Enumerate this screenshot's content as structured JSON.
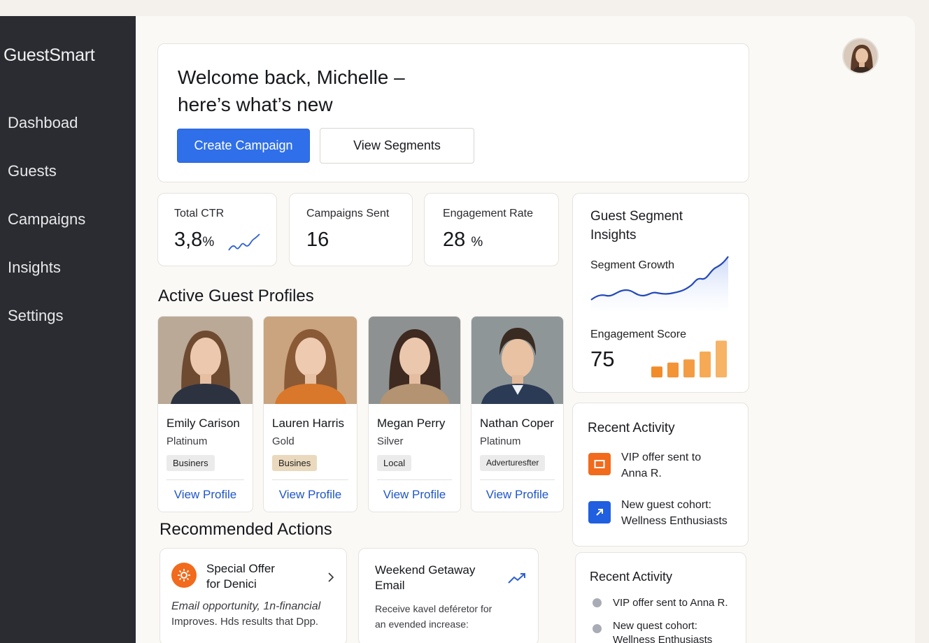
{
  "app": {
    "name": "GuestSmart"
  },
  "sidebar": {
    "items": [
      {
        "label": "Dashboad"
      },
      {
        "label": "Guests"
      },
      {
        "label": "Campaigns"
      },
      {
        "label": "Insights"
      },
      {
        "label": "Settings"
      }
    ]
  },
  "welcome": {
    "line1": "Welcome back, Michelle –",
    "line2": "here’s what’s new",
    "primary_label": "Create Campaign",
    "secondary_label": "View Segments"
  },
  "stats": [
    {
      "label": "Total CTR",
      "value": "3,8",
      "unit": "%"
    },
    {
      "label": "Campaigns Sent",
      "value": "16",
      "unit": ""
    },
    {
      "label": "Engagement Rate",
      "value": "28",
      "unit": "%"
    }
  ],
  "profiles_section": {
    "title": "Active Guest Profiles"
  },
  "profiles": [
    {
      "name": "Emily Carison",
      "tier": "Platinum",
      "tag": "Businers",
      "link": "View Profile",
      "tag_color": "#ebebec",
      "photo_bg": "#b9a996"
    },
    {
      "name": "Lauren Harris",
      "tier": "Gold",
      "tag": "Busines",
      "link": "View Profile",
      "tag_color": "#ead9bd",
      "photo_bg": "#c9a47e"
    },
    {
      "name": "Megan Perry",
      "tier": "Silver",
      "tag": "Local",
      "link": "View Profile",
      "tag_color": "#ebebec",
      "photo_bg": "#8d9191"
    },
    {
      "name": "Nathan Coper",
      "tier": "Platinum",
      "tag": "Adverturesfter",
      "link": "View Profile",
      "tag_color": "#ebebec",
      "photo_bg": "#8e9698"
    }
  ],
  "insights": {
    "title_line1": "Guest Segment",
    "title_line2": "Insights",
    "growth_label": "Segment Growth",
    "score_label": "Engagement Score",
    "score_value": "75",
    "score_bars": [
      0.28,
      0.38,
      0.46,
      0.66,
      0.94
    ]
  },
  "recent_activity": {
    "title": "Recent Activity",
    "items": [
      {
        "line1": "VIP offer sent to",
        "line2": "Anna R.",
        "icon": "offer-icon",
        "color": "#f26a1b"
      },
      {
        "line1": "New guest cohort:",
        "line2": "Wellness Enthusiasts",
        "icon": "arrow-up-right-icon",
        "color": "#1f5fe0"
      }
    ]
  },
  "recent_activity_2": {
    "title": "Recent Activity",
    "items": [
      {
        "line1": "VIP offer sent to Anna R."
      },
      {
        "line1": "New quest cohort:",
        "line2": "Wellness Enthusiasts"
      }
    ]
  },
  "recommended": {
    "title": "Recommended Actions",
    "items": [
      {
        "title_line1": "Special Offer",
        "title_line2": "for Denici",
        "body_line1": "Email opportunity, 1n-financial",
        "body_line2": "Improves. Hds results that Dpp."
      },
      {
        "title_line1": "Weekend Getaway",
        "title_line2": "Email",
        "body_line1": "Receive kavel deféretor for",
        "body_line2": "an evended increase:"
      }
    ]
  }
}
